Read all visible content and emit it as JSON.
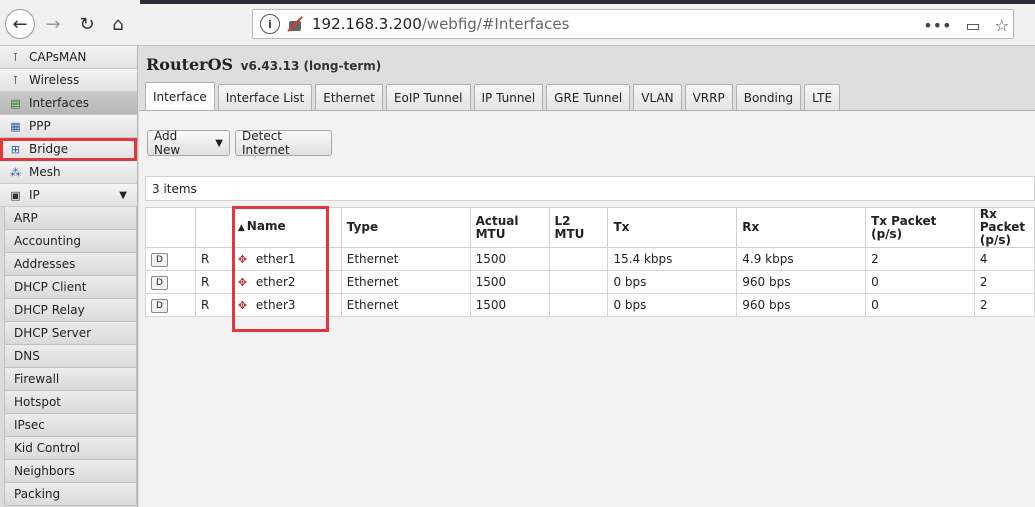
{
  "browser": {
    "url_host": "192.168.3.200",
    "url_path": "/webfig/#Interfaces",
    "more_glyph": "•••"
  },
  "sidebar": {
    "items": [
      {
        "label": "CAPsMAN",
        "icon": "antenna-icon"
      },
      {
        "label": "Wireless",
        "icon": "antenna-icon"
      },
      {
        "label": "Interfaces",
        "icon": "interfaces-icon"
      },
      {
        "label": "PPP",
        "icon": "ppp-icon"
      },
      {
        "label": "Bridge",
        "icon": "bridge-icon"
      },
      {
        "label": "Mesh",
        "icon": "mesh-icon"
      },
      {
        "label": "IP",
        "icon": "ip-icon"
      }
    ],
    "ip_submenu": [
      "ARP",
      "Accounting",
      "Addresses",
      "DHCP Client",
      "DHCP Relay",
      "DHCP Server",
      "DNS",
      "Firewall",
      "Hotspot",
      "IPsec",
      "Kid Control",
      "Neighbors",
      "Packing"
    ]
  },
  "header": {
    "title": "RouterOS",
    "version": "v6.43.13 (long-term)"
  },
  "tabs": [
    "Interface",
    "Interface List",
    "Ethernet",
    "EoIP Tunnel",
    "IP Tunnel",
    "GRE Tunnel",
    "VLAN",
    "VRRP",
    "Bonding",
    "LTE"
  ],
  "toolbar": {
    "add_new": "Add New",
    "detect_internet": "Detect Internet"
  },
  "items_count": "3 items",
  "table": {
    "columns": [
      "",
      "",
      "Name",
      "Type",
      "Actual MTU",
      "L2 MTU",
      "Tx",
      "Rx",
      "Tx Packet (p/s)",
      "Rx Packet (p/s)"
    ],
    "rows": [
      {
        "btn": "D",
        "flag": "R",
        "name": "ether1",
        "type": "Ethernet",
        "mtu": "1500",
        "l2mtu": "",
        "tx": "15.4 kbps",
        "rx": "4.9 kbps",
        "txp": "2",
        "rxp": "4"
      },
      {
        "btn": "D",
        "flag": "R",
        "name": "ether2",
        "type": "Ethernet",
        "mtu": "1500",
        "l2mtu": "",
        "tx": "0 bps",
        "rx": "960 bps",
        "txp": "0",
        "rxp": "2"
      },
      {
        "btn": "D",
        "flag": "R",
        "name": "ether3",
        "type": "Ethernet",
        "mtu": "1500",
        "l2mtu": "",
        "tx": "0 bps",
        "rx": "960 bps",
        "txp": "0",
        "rxp": "2"
      }
    ]
  },
  "colors": {
    "highlight": "#e0383d"
  }
}
